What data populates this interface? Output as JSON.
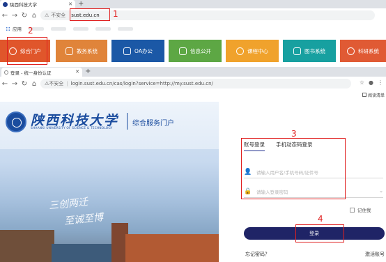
{
  "window1": {
    "tab_title": "陕西科技大学",
    "address_insecure": "不安全",
    "address_url": "sust.edu.cn",
    "bookmarks_label": "应用",
    "portal_nav": [
      {
        "label": "综合门户",
        "color": "#e0562b"
      },
      {
        "label": "教务系统",
        "color": "#e0843a"
      },
      {
        "label": "OA办公",
        "color": "#1b58a6"
      },
      {
        "label": "信息公开",
        "color": "#5da744"
      },
      {
        "label": "课程中心",
        "color": "#f0a22c"
      },
      {
        "label": "图书系统",
        "color": "#17a0a0"
      },
      {
        "label": "科研系统",
        "color": "#e05a34"
      }
    ]
  },
  "window2": {
    "tab_title": "登录 - 统一身份认证",
    "address_insecure": "不安全",
    "address_url": "login.sust.edu.cn/cas/login?service=http://my.sust.edu.cn/",
    "reading_mode": "阅读清单",
    "university_name_cn": "陕西科技大学",
    "university_name_en": "SHAANXI UNIVERSITY OF SCIENCE & TECHNOLOGY",
    "portal_name": "综合服务门户",
    "motto_line1": "三创两迁",
    "motto_line2": "至诚至博",
    "login": {
      "tab_account": "账号登录",
      "tab_sms": "手机动态码登录",
      "username_placeholder": "请输入用户名/手机号码/证件号",
      "password_placeholder": "请输入登录密码",
      "remember": "记住我",
      "login_button": "登录",
      "forgot": "忘记密码？",
      "activate": "激活账号"
    }
  },
  "annotations": [
    "1",
    "2",
    "3",
    "4"
  ],
  "colors": {
    "annotation": "#e02020",
    "login_button": "#1f2466"
  }
}
